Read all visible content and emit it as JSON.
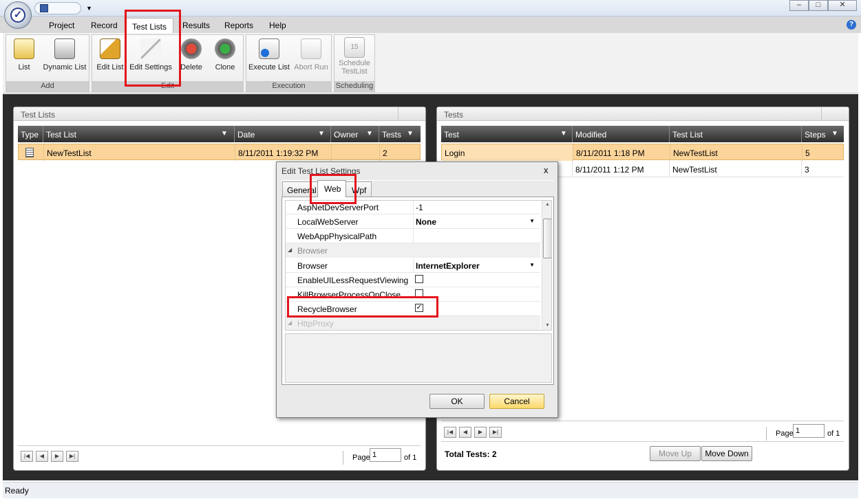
{
  "window": {
    "title": ""
  },
  "ribbon": {
    "tabs": [
      "Project",
      "Record",
      "Test Lists",
      "Results",
      "Reports",
      "Help"
    ],
    "groups": [
      {
        "label": "Add",
        "buttons": [
          "List",
          "Dynamic List"
        ]
      },
      {
        "label": "Edit",
        "buttons": [
          "Edit List",
          "Edit Settings",
          "Delete",
          "Clone"
        ]
      },
      {
        "label": "Execution",
        "buttons": [
          "Execute List",
          "Abort Run"
        ]
      },
      {
        "label": "Scheduling",
        "buttons": [
          "Schedule TestList"
        ]
      }
    ],
    "help_symbol": "?"
  },
  "test_lists_panel": {
    "title": "Test Lists",
    "columns": [
      "Type",
      "Test List",
      "Date",
      "Owner",
      "Tests"
    ],
    "rows": [
      {
        "type_icon": "list-icon",
        "name": "NewTestList",
        "date": "8/11/2011 1:19:32 PM",
        "owner": "",
        "tests": "2"
      }
    ],
    "pager": {
      "page_label": "Page",
      "page_value": "1",
      "of_label": "of 1"
    }
  },
  "tests_panel": {
    "title": "Tests",
    "columns": [
      "Test",
      "Modified",
      "Test List",
      "Steps"
    ],
    "rows": [
      {
        "test": "Login",
        "modified": "8/11/2011 1:18 PM",
        "list": "NewTestList",
        "steps": "5"
      },
      {
        "test": "",
        "modified": "8/11/2011 1:12 PM",
        "list": "NewTestList",
        "steps": "3"
      }
    ],
    "pager": {
      "page_label": "Page",
      "page_value": "1",
      "of_label": "of 1"
    },
    "total_tests": "Total Tests: 2",
    "move_up": "Move Up",
    "move_down": "Move Down"
  },
  "dialog": {
    "title": "Edit Test List Settings",
    "close": "x",
    "tabs": [
      "General",
      "Web",
      "Wpf"
    ],
    "properties": [
      {
        "name": "AspNetDevServerPort",
        "value": "-1"
      },
      {
        "name": "LocalWebServer",
        "value": "None"
      },
      {
        "name": "WebAppPhysicalPath",
        "value": ""
      }
    ],
    "category_browser": "Browser",
    "browser_properties": [
      {
        "name": "Browser",
        "value": "InternetExplorer"
      },
      {
        "name": "EnableUILessRequestViewing",
        "checked": false
      },
      {
        "name": "KillBrowserProcessOnClose",
        "checked": false
      },
      {
        "name": "RecycleBrowser",
        "checked": true
      }
    ],
    "category_proxy": "HttpProxy",
    "ok": "OK",
    "cancel": "Cancel"
  },
  "status": {
    "text": "Ready"
  }
}
